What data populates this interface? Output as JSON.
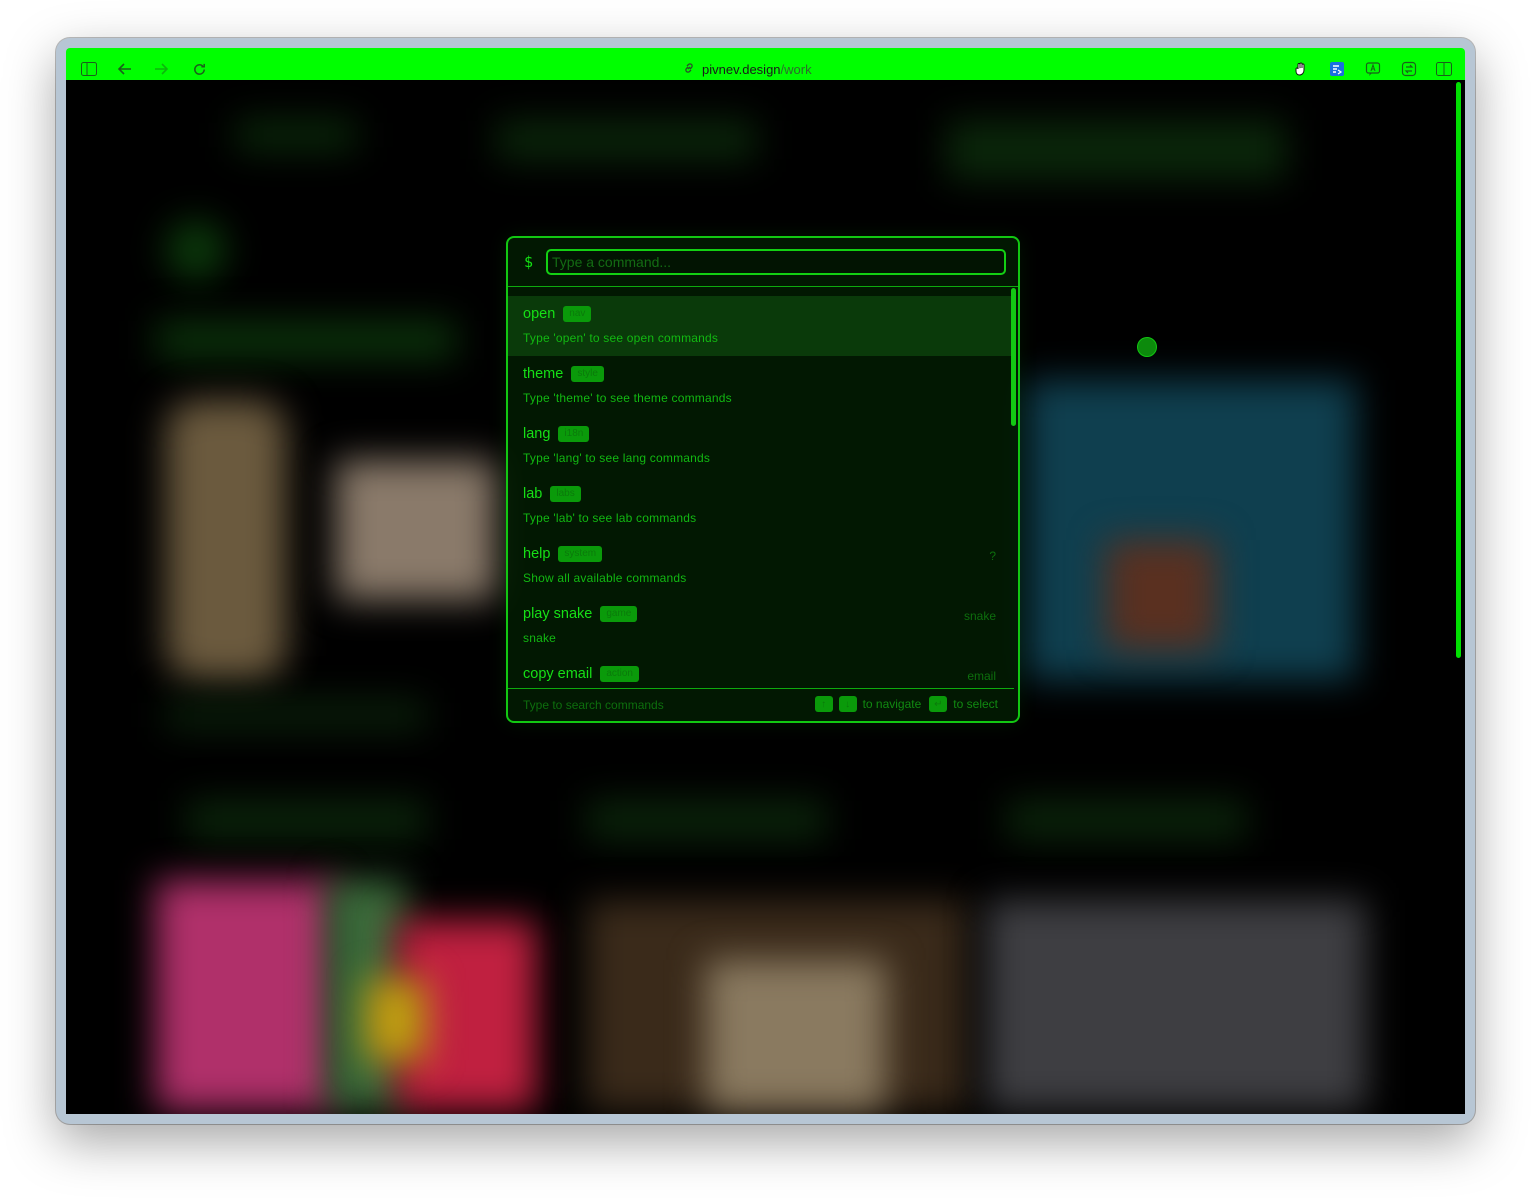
{
  "browser": {
    "url_host": "pivnev.design",
    "url_path": "/work",
    "icons": [
      "sidebar-icon",
      "back-arrow-icon",
      "forward-arrow-icon",
      "reload-icon",
      "link-icon",
      "hand-cursor-extension-icon",
      "translate-extension-icon",
      "reader-extension-icon",
      "sync-extension-icon",
      "split-view-icon"
    ]
  },
  "theme": {
    "accent": "#00ff00",
    "background": "#000000",
    "panel": "#021c02"
  },
  "palette": {
    "prompt": "$",
    "input": {
      "value": "",
      "placeholder": "Type a command..."
    },
    "items": [
      {
        "name": "open",
        "badge": "nav",
        "description": "Type 'open' to see open commands",
        "hint": ""
      },
      {
        "name": "theme",
        "badge": "style",
        "description": "Type 'theme' to see theme commands",
        "hint": ""
      },
      {
        "name": "lang",
        "badge": "i18n",
        "description": "Type 'lang' to see lang commands",
        "hint": ""
      },
      {
        "name": "lab",
        "badge": "labs",
        "description": "Type 'lab' to see lab commands",
        "hint": ""
      },
      {
        "name": "help",
        "badge": "system",
        "description": "Show all available commands",
        "hint": "?"
      },
      {
        "name": "play snake",
        "badge": "game",
        "description": "snake",
        "hint": "snake"
      },
      {
        "name": "copy email",
        "badge": "action",
        "description": "",
        "hint": "email"
      }
    ],
    "footer": {
      "left": "Type to search commands",
      "up_key": "↑",
      "down_key": "↓",
      "navigate_label": "to navigate",
      "enter_key": "↵",
      "select_label": "to select"
    }
  }
}
